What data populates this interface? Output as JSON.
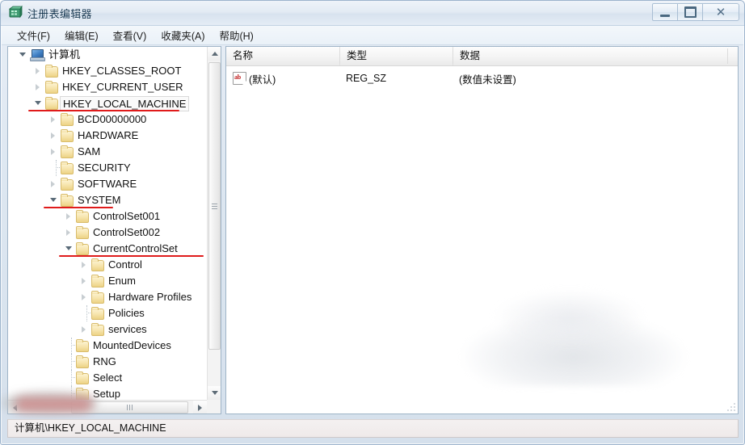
{
  "window": {
    "title": "注册表编辑器",
    "icon": "registry-editor-icon",
    "controls": {
      "minimize": "最小化",
      "maximize": "最大化",
      "close": "关闭",
      "close_glyph": "✕"
    }
  },
  "menu": {
    "items": [
      {
        "label": "文件(F)",
        "name": "menu-file"
      },
      {
        "label": "编辑(E)",
        "name": "menu-edit"
      },
      {
        "label": "查看(V)",
        "name": "menu-view"
      },
      {
        "label": "收藏夹(A)",
        "name": "menu-favorites"
      },
      {
        "label": "帮助(H)",
        "name": "menu-help"
      }
    ]
  },
  "tree": {
    "nodes": [
      {
        "label": "计算机",
        "depth": 0,
        "state": "expanded",
        "icon": "computer-icon",
        "selected": false,
        "underline": false
      },
      {
        "label": "HKEY_CLASSES_ROOT",
        "depth": 1,
        "state": "collapsed",
        "icon": "folder-icon",
        "selected": false,
        "underline": false
      },
      {
        "label": "HKEY_CURRENT_USER",
        "depth": 1,
        "state": "collapsed",
        "icon": "folder-icon",
        "selected": false,
        "underline": false
      },
      {
        "label": "HKEY_LOCAL_MACHINE",
        "depth": 1,
        "state": "expanded",
        "icon": "folder-icon",
        "selected": true,
        "underline": true
      },
      {
        "label": "BCD00000000",
        "depth": 2,
        "state": "collapsed",
        "icon": "folder-icon",
        "selected": false,
        "underline": false
      },
      {
        "label": "HARDWARE",
        "depth": 2,
        "state": "collapsed",
        "icon": "folder-icon",
        "selected": false,
        "underline": false
      },
      {
        "label": "SAM",
        "depth": 2,
        "state": "collapsed",
        "icon": "folder-icon",
        "selected": false,
        "underline": false
      },
      {
        "label": "SECURITY",
        "depth": 2,
        "state": "leaf",
        "icon": "folder-icon",
        "selected": false,
        "underline": false
      },
      {
        "label": "SOFTWARE",
        "depth": 2,
        "state": "collapsed",
        "icon": "folder-icon",
        "selected": false,
        "underline": false
      },
      {
        "label": "SYSTEM",
        "depth": 2,
        "state": "expanded",
        "icon": "folder-icon",
        "selected": false,
        "underline": true
      },
      {
        "label": "ControlSet001",
        "depth": 3,
        "state": "collapsed",
        "icon": "folder-icon",
        "selected": false,
        "underline": false
      },
      {
        "label": "ControlSet002",
        "depth": 3,
        "state": "collapsed",
        "icon": "folder-icon",
        "selected": false,
        "underline": false
      },
      {
        "label": "CurrentControlSet",
        "depth": 3,
        "state": "expanded",
        "icon": "folder-icon",
        "selected": false,
        "underline": true
      },
      {
        "label": "Control",
        "depth": 4,
        "state": "collapsed",
        "icon": "folder-icon",
        "selected": false,
        "underline": false
      },
      {
        "label": "Enum",
        "depth": 4,
        "state": "collapsed",
        "icon": "folder-icon",
        "selected": false,
        "underline": false
      },
      {
        "label": "Hardware Profiles",
        "depth": 4,
        "state": "collapsed",
        "icon": "folder-icon",
        "selected": false,
        "underline": false
      },
      {
        "label": "Policies",
        "depth": 4,
        "state": "leaf",
        "icon": "folder-icon",
        "selected": false,
        "underline": false
      },
      {
        "label": "services",
        "depth": 4,
        "state": "collapsed",
        "icon": "folder-icon",
        "selected": false,
        "underline": false
      },
      {
        "label": "MountedDevices",
        "depth": 3,
        "state": "leaf",
        "icon": "folder-icon",
        "selected": false,
        "underline": false
      },
      {
        "label": "RNG",
        "depth": 3,
        "state": "leaf",
        "icon": "folder-icon",
        "selected": false,
        "underline": false
      },
      {
        "label": "Select",
        "depth": 3,
        "state": "leaf",
        "icon": "folder-icon",
        "selected": false,
        "underline": false
      },
      {
        "label": "Setup",
        "depth": 3,
        "state": "leaf",
        "icon": "folder-icon",
        "selected": false,
        "underline": false
      }
    ]
  },
  "list": {
    "columns": [
      {
        "label": "名称",
        "name": "column-name"
      },
      {
        "label": "类型",
        "name": "column-type"
      },
      {
        "label": "数据",
        "name": "column-data"
      }
    ],
    "rows": [
      {
        "name": "(默认)",
        "type": "REG_SZ",
        "data": "(数值未设置)",
        "icon": "string-value-icon"
      }
    ]
  },
  "status": {
    "path": "计算机\\HKEY_LOCAL_MACHINE"
  },
  "colors": {
    "underline_red": "#e01b1b",
    "title_text": "#12344f",
    "folder_yellow": "#f6e3a9",
    "window_border": "#9bb3cc"
  }
}
